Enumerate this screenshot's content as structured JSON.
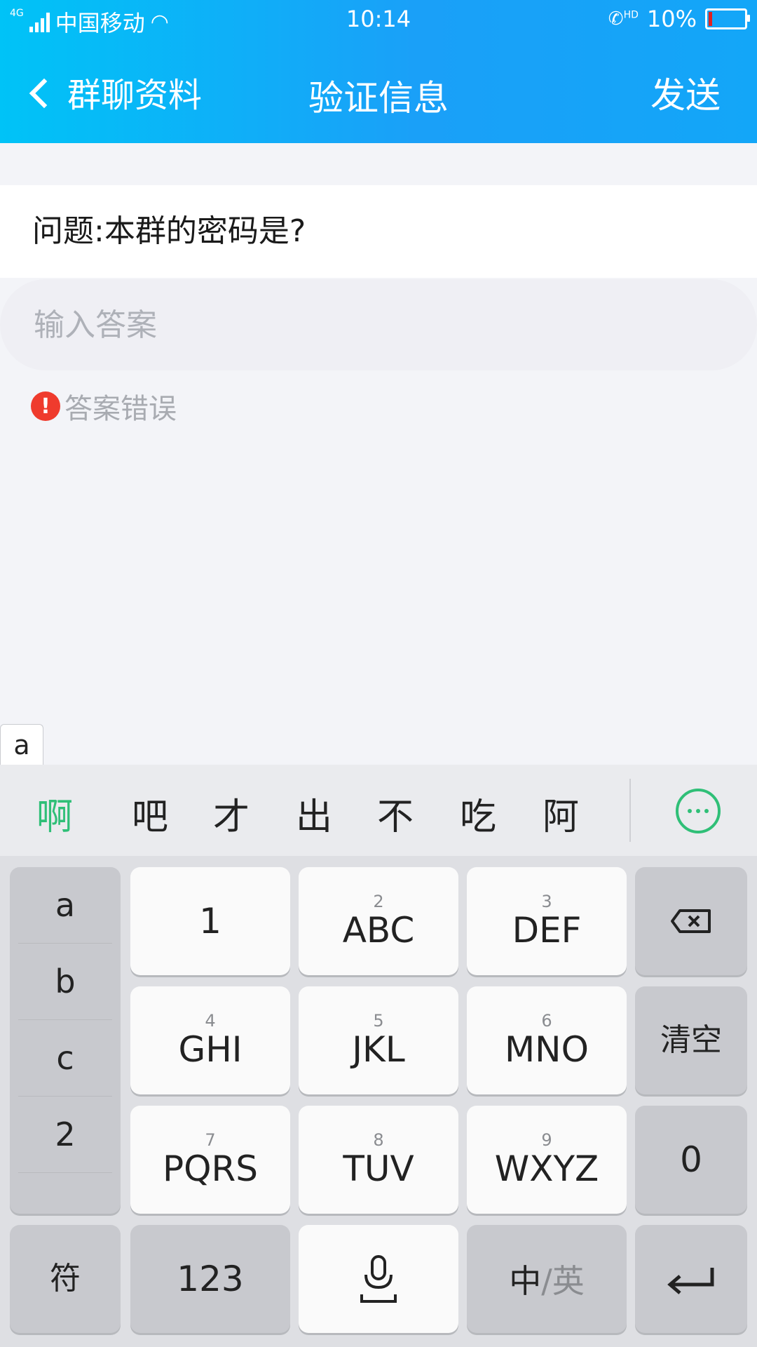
{
  "status": {
    "carrier": "中国移动",
    "time": "10:14",
    "battery": "10%",
    "battery_level": 0.1
  },
  "header": {
    "back_label": "群聊资料",
    "title": "验证信息",
    "send_label": "发送"
  },
  "question": "问题:本群的密码是?",
  "answer": {
    "placeholder": "输入答案",
    "value": ""
  },
  "error": "答案错误",
  "preview_letter": "a",
  "candidates": [
    "啊",
    "吧",
    "才",
    "出",
    "不",
    "吃",
    "阿"
  ],
  "keyboard": {
    "left_column": [
      "a",
      "b",
      "c",
      "2"
    ],
    "rows": [
      [
        {
          "num": "",
          "label": "1"
        },
        {
          "num": "2",
          "label": "ABC"
        },
        {
          "num": "3",
          "label": "DEF"
        }
      ],
      [
        {
          "num": "4",
          "label": "GHI"
        },
        {
          "num": "5",
          "label": "JKL"
        },
        {
          "num": "6",
          "label": "MNO"
        }
      ],
      [
        {
          "num": "7",
          "label": "PQRS"
        },
        {
          "num": "8",
          "label": "TUV"
        },
        {
          "num": "9",
          "label": "WXYZ"
        }
      ]
    ],
    "clear_label": "清空",
    "zero_label": "0",
    "symbol_label": "符",
    "num_label": "123",
    "lang_zh": "中",
    "lang_sep": "/",
    "lang_en": "英"
  },
  "colors": {
    "accent": "#2fbf77",
    "header_start": "#00c3f7",
    "header_end": "#13a6f8",
    "error": "#ef3b2d"
  }
}
